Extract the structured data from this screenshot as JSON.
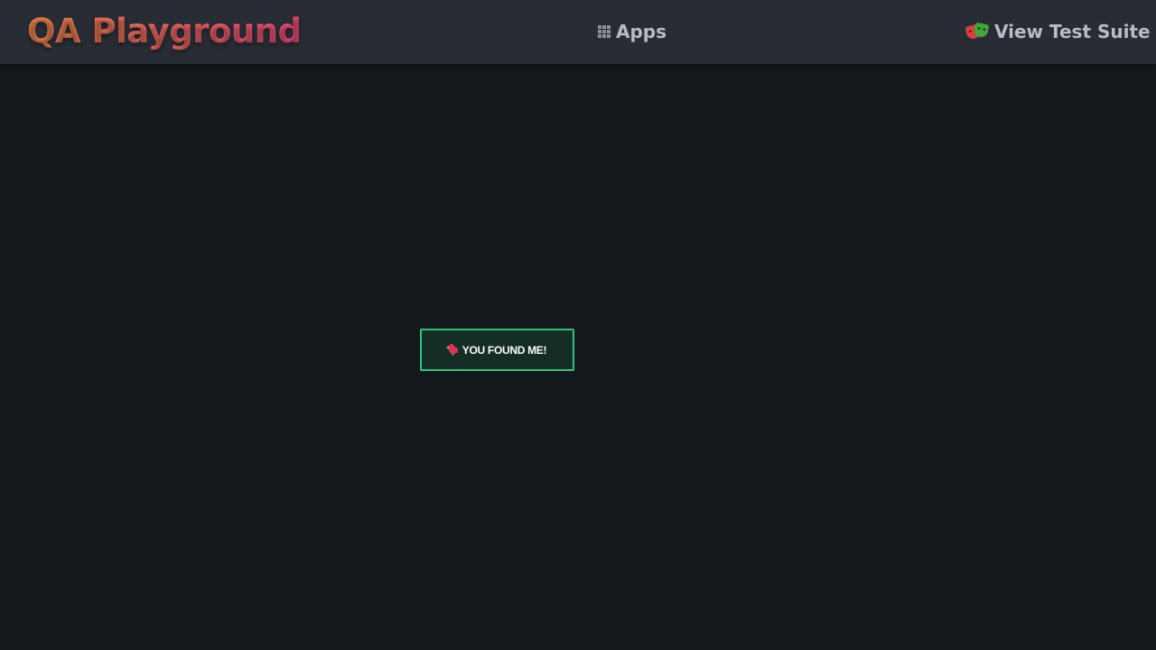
{
  "navbar": {
    "brand": "QA Playground",
    "apps_label": "Apps",
    "apps_icon": "apps-grid-icon",
    "suite_label": "View Test Suite",
    "suite_icon": "theater-masks-icon"
  },
  "main": {
    "found_button_label": "YOU FOUND ME!",
    "found_button_icon": "bird-icon"
  },
  "colors": {
    "page_bg": "#14181c",
    "navbar_bg": "#282c34",
    "brand_gradient_start": "#f0844c",
    "brand_gradient_end": "#ee4b7a",
    "nav_text": "#b7bcc6",
    "button_bg": "#142e25",
    "button_border": "#2fc57a"
  }
}
